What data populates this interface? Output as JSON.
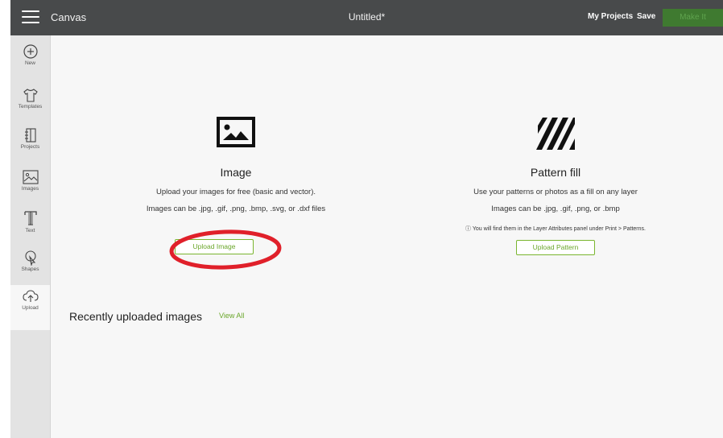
{
  "topbar": {
    "app_name": "Canvas",
    "document_title": "Untitled*",
    "my_projects": "My Projects",
    "save": "Save",
    "make_it": "Make It"
  },
  "sidebar": {
    "items": [
      {
        "label": "New",
        "icon": "plus-circle-icon"
      },
      {
        "label": "Templates",
        "icon": "shirt-icon"
      },
      {
        "label": "Projects",
        "icon": "projects-icon"
      },
      {
        "label": "Images",
        "icon": "image-icon"
      },
      {
        "label": "Text",
        "icon": "text-icon"
      },
      {
        "label": "Shapes",
        "icon": "shapes-icon"
      },
      {
        "label": "Upload",
        "icon": "upload-icon",
        "active": true
      }
    ]
  },
  "image_section": {
    "title": "Image",
    "line1": "Upload your images for free (basic and vector).",
    "line2": "Images can be .jpg, .gif, .png, .bmp, .svg, or .dxf files",
    "button": "Upload Image"
  },
  "pattern_section": {
    "title": "Pattern fill",
    "line1": "Use your patterns or photos as a fill on any layer",
    "line2": "Images can be .jpg, .gif, .png, or .bmp",
    "note": "ⓘ You will find them in the Layer Attributes panel under Print > Patterns.",
    "button": "Upload Pattern"
  },
  "recent": {
    "title": "Recently uploaded images",
    "view_all": "View All"
  },
  "colors": {
    "topbar": "#484a4b",
    "accent_green": "#6aa62a",
    "make_it_bg": "#3f7a30",
    "highlight_red": "#e0202a"
  }
}
